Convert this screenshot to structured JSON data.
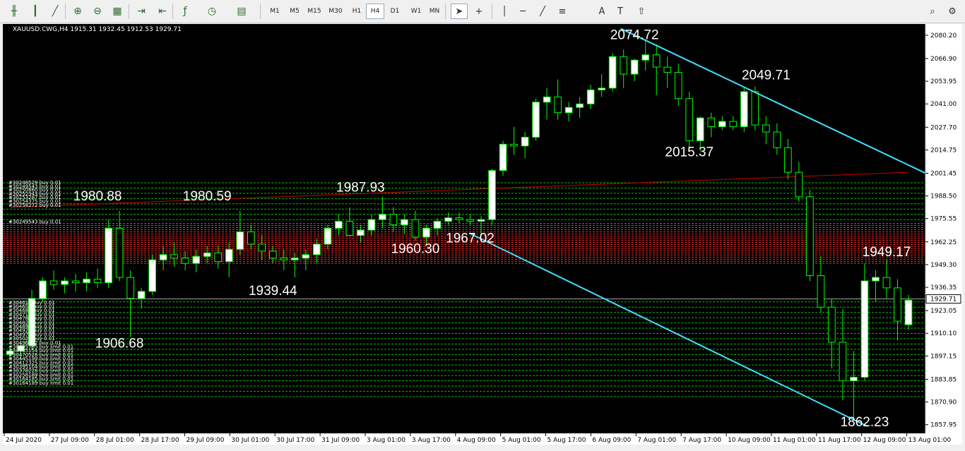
{
  "toolbar": {
    "timeframes": [
      "M1",
      "M5",
      "M15",
      "M30",
      "H1",
      "H4",
      "D1",
      "W1",
      "MN"
    ],
    "active_timeframe": "H4",
    "icons": [
      "bar-chart-icon",
      "candle-chart-icon",
      "line-chart-icon",
      "zoom-in-icon",
      "zoom-out-icon",
      "tile-windows-icon",
      "autoscroll-icon",
      "chart-shift-icon",
      "indicators-icon",
      "periods-icon",
      "templates-icon",
      "cursor-icon",
      "crosshair-icon",
      "vertical-line-icon",
      "horizontal-line-icon",
      "trendline-icon",
      "fibonacci-icon",
      "text-icon",
      "label-icon",
      "arrows-icon",
      "search-icon",
      "settings-icon"
    ]
  },
  "chart": {
    "symbol_line": "XAUUSD.CWG,H4  1915.31 1932.45 1912.53 1929.71",
    "current_price_label": "1929.71",
    "current_price": 1929.71,
    "colors": {
      "background": "#000000",
      "bull_body": "#ffffff",
      "bear_body": "#000000",
      "wick": "#00ff00",
      "buy_level": "#00c000",
      "sell_level": "#ff2a2a",
      "trendline": "#40e0ff",
      "ma": "#cc0000",
      "price_line": "#a0a0a0"
    }
  },
  "chart_data": {
    "type": "candlestick",
    "title": "XAUUSD.CWG,H4",
    "ylim": [
      1853.0,
      2085.0
    ],
    "y_ticks": [
      "2080.20",
      "2066.90",
      "2053.95",
      "2041.00",
      "2027.70",
      "2014.75",
      "2001.45",
      "1988.50",
      "1975.55",
      "1962.25",
      "1949.30",
      "1936.35",
      "1923.05",
      "1910.10",
      "1897.15",
      "1883.85",
      "1870.90",
      "1857.95"
    ],
    "x_ticks": [
      "24 Jul 2020",
      "27 Jul 09:00",
      "28 Jul 01:00",
      "28 Jul 17:00",
      "29 Jul 09:00",
      "30 Jul 01:00",
      "30 Jul 17:00",
      "31 Jul 09:00",
      "3 Aug 01:00",
      "3 Aug 17:00",
      "4 Aug 09:00",
      "5 Aug 01:00",
      "5 Aug 17:00",
      "6 Aug 09:00",
      "7 Aug 01:00",
      "7 Aug 17:00",
      "10 Aug 09:00",
      "11 Aug 01:00",
      "11 Aug 17:00",
      "12 Aug 09:00",
      "13 Aug 01:00"
    ],
    "candles": [
      [
        1898,
        1902,
        1896,
        1900
      ],
      [
        1900,
        1905,
        1895,
        1903
      ],
      [
        1903,
        1935,
        1900,
        1930
      ],
      [
        1930,
        1942,
        1928,
        1940
      ],
      [
        1940,
        1946,
        1935,
        1938
      ],
      [
        1938,
        1942,
        1933,
        1940
      ],
      [
        1940,
        1944,
        1934,
        1939
      ],
      [
        1939,
        1945,
        1934,
        1941
      ],
      [
        1941,
        1947,
        1936,
        1939
      ],
      [
        1939,
        1975,
        1936,
        1970
      ],
      [
        1970,
        1980,
        1940,
        1942
      ],
      [
        1942,
        1946,
        1908,
        1930
      ],
      [
        1930,
        1936,
        1924,
        1934
      ],
      [
        1934,
        1955,
        1932,
        1952
      ],
      [
        1952,
        1960,
        1946,
        1955
      ],
      [
        1955,
        1962,
        1948,
        1953
      ],
      [
        1953,
        1957,
        1946,
        1950
      ],
      [
        1950,
        1958,
        1945,
        1954
      ],
      [
        1954,
        1960,
        1950,
        1956
      ],
      [
        1956,
        1960,
        1947,
        1951
      ],
      [
        1951,
        1962,
        1942,
        1958
      ],
      [
        1958,
        1980,
        1955,
        1968
      ],
      [
        1968,
        1972,
        1958,
        1961
      ],
      [
        1961,
        1966,
        1952,
        1957
      ],
      [
        1957,
        1960,
        1950,
        1953
      ],
      [
        1953,
        1958,
        1946,
        1952
      ],
      [
        1952,
        1956,
        1942,
        1953
      ],
      [
        1953,
        1958,
        1946,
        1955
      ],
      [
        1955,
        1964,
        1950,
        1961
      ],
      [
        1961,
        1972,
        1958,
        1970
      ],
      [
        1970,
        1978,
        1966,
        1974
      ],
      [
        1974,
        1982,
        1970,
        1966
      ],
      [
        1966,
        1972,
        1962,
        1969
      ],
      [
        1969,
        1978,
        1966,
        1975
      ],
      [
        1975,
        1988,
        1970,
        1978
      ],
      [
        1978,
        1982,
        1968,
        1972
      ],
      [
        1972,
        1978,
        1967,
        1975
      ],
      [
        1975,
        1980,
        1963,
        1965
      ],
      [
        1965,
        1972,
        1960,
        1970
      ],
      [
        1970,
        1976,
        1966,
        1974
      ],
      [
        1974,
        1979,
        1972,
        1976
      ],
      [
        1976,
        1979,
        1973,
        1975
      ],
      [
        1975,
        1978,
        1972,
        1974
      ],
      [
        1974,
        1977,
        1967,
        1975
      ],
      [
        1975,
        2004,
        1972,
        2003
      ],
      [
        2003,
        2020,
        2000,
        2018
      ],
      [
        2018,
        2028,
        2012,
        2017
      ],
      [
        2017,
        2025,
        2010,
        2022
      ],
      [
        2022,
        2044,
        2020,
        2042
      ],
      [
        2042,
        2050,
        2032,
        2045
      ],
      [
        2045,
        2055,
        2032,
        2036
      ],
      [
        2036,
        2042,
        2031,
        2039
      ],
      [
        2039,
        2045,
        2033,
        2041
      ],
      [
        2041,
        2052,
        2038,
        2049
      ],
      [
        2049,
        2058,
        2045,
        2050
      ],
      [
        2050,
        2070,
        2048,
        2068
      ],
      [
        2068,
        2072,
        2050,
        2058
      ],
      [
        2058,
        2067,
        2054,
        2066
      ],
      [
        2066,
        2078,
        2060,
        2069
      ],
      [
        2069,
        2075,
        2046,
        2062
      ],
      [
        2062,
        2068,
        2050,
        2059
      ],
      [
        2059,
        2064,
        2040,
        2044
      ],
      [
        2044,
        2048,
        2014,
        2020
      ],
      [
        2020,
        2034,
        2014,
        2033
      ],
      [
        2033,
        2036,
        2022,
        2028
      ],
      [
        2028,
        2034,
        2026,
        2031
      ],
      [
        2031,
        2034,
        2026,
        2028
      ],
      [
        2028,
        2050,
        2025,
        2048
      ],
      [
        2048,
        2051,
        2026,
        2029
      ],
      [
        2029,
        2034,
        2018,
        2025
      ],
      [
        2025,
        2030,
        2012,
        2016
      ],
      [
        2016,
        2021,
        1998,
        2002
      ],
      [
        2002,
        2008,
        1985,
        1988
      ],
      [
        1988,
        1992,
        1940,
        1943
      ],
      [
        1943,
        1954,
        1922,
        1925
      ],
      [
        1925,
        1930,
        1890,
        1905
      ],
      [
        1905,
        1924,
        1872,
        1883
      ],
      [
        1883,
        1900,
        1862,
        1885
      ],
      [
        1885,
        1950,
        1883,
        1940
      ],
      [
        1940,
        1946,
        1928,
        1942
      ],
      [
        1942,
        1952,
        1930,
        1936
      ],
      [
        1936,
        1941,
        1906,
        1917
      ],
      [
        1915,
        1932,
        1912,
        1929
      ]
    ],
    "annotations": [
      {
        "label": "2074.72",
        "price": 2074.72
      },
      {
        "label": "2049.71",
        "price": 2049.71
      },
      {
        "label": "2015.37",
        "price": 2015.37
      },
      {
        "label": "1980.88",
        "price": 1980.88
      },
      {
        "label": "1980.59",
        "price": 1980.59
      },
      {
        "label": "1987.93",
        "price": 1987.93
      },
      {
        "label": "1960.30",
        "price": 1960.3
      },
      {
        "label": "1967.02",
        "price": 1967.02
      },
      {
        "label": "1939.44",
        "price": 1939.44
      },
      {
        "label": "1906.68",
        "price": 1906.68
      },
      {
        "label": "1949.17",
        "price": 1949.17
      },
      {
        "label": "1862.23",
        "price": 1862.23
      }
    ],
    "order_labels_upper": [
      "#30248529 buy 0.01",
      "#30249543 buy 0.01",
      "#30250860 buy 0.01",
      "#30252343 buy 0.01",
      "#30253287 buy 0.01",
      "#30254375 buy 0.01",
      "#30258272 buy 0.01"
    ],
    "order_labels_mid": [
      "#30249543 buy 0.01"
    ],
    "order_labels_lower": [
      "#304611 buy 0.01",
      "#304657 buy 0.01",
      "#304685 buy 0.01",
      "#304715 buy 0.01",
      "#304785 buy 0.01",
      "#304823 buy 0.01",
      "#304897 buy 0.01",
      "#304925 buy 0.01",
      "#304971 buy 0.01",
      "#305023 buy 0.01",
      "#30496452 buy 0.01",
      "#30495785 buy limit 0.01",
      "#30485154 buy limit 0.01",
      "#30470528 buy limit 0.01",
      "#30445199 buy limit 0.01",
      "#30412325 buy limit 0.01",
      "#30395104 buy limit 0.01",
      "#30378228 buy limit 0.01",
      "#30258189 buy limit 0.01",
      "#30164185 buy limit 0.01",
      "#30164189 buy limit 0.01"
    ]
  }
}
